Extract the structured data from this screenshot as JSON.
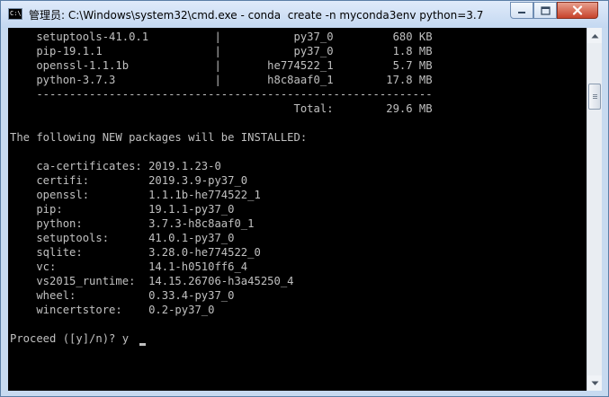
{
  "window": {
    "title": "管理员: C:\\Windows\\system32\\cmd.exe - conda  create -n myconda3env python=3.7",
    "icon": "cmd-icon",
    "icon_text": "C:\\"
  },
  "console": {
    "lines": [
      "    setuptools-41.0.1          |           py37_0         680 KB",
      "    pip-19.1.1                 |           py37_0         1.8 MB",
      "    openssl-1.1.1b             |       he774522_1         5.7 MB",
      "    python-3.7.3               |       h8c8aaf0_1        17.8 MB",
      "    ------------------------------------------------------------",
      "                                           Total:        29.6 MB",
      "",
      "The following NEW packages will be INSTALLED:",
      "",
      "    ca-certificates: 2019.1.23-0",
      "    certifi:         2019.3.9-py37_0",
      "    openssl:         1.1.1b-he774522_1",
      "    pip:             19.1.1-py37_0",
      "    python:          3.7.3-h8c8aaf0_1",
      "    setuptools:      41.0.1-py37_0",
      "    sqlite:          3.28.0-he774522_0",
      "    vc:              14.1-h0510ff6_4",
      "    vs2015_runtime:  14.15.26706-h3a45250_4",
      "    wheel:           0.33.4-py37_0",
      "    wincertstore:    0.2-py37_0",
      "",
      "Proceed ([y]/n)? y"
    ],
    "text_color": "#c0c0c0",
    "background_color": "#000000"
  },
  "controls": {
    "minimize_icon": "minimize-icon",
    "maximize_icon": "maximize-icon",
    "close_icon": "close-icon"
  },
  "scrollbar": {
    "up_icon": "scroll-up-arrow-icon",
    "down_icon": "scroll-down-arrow-icon"
  }
}
